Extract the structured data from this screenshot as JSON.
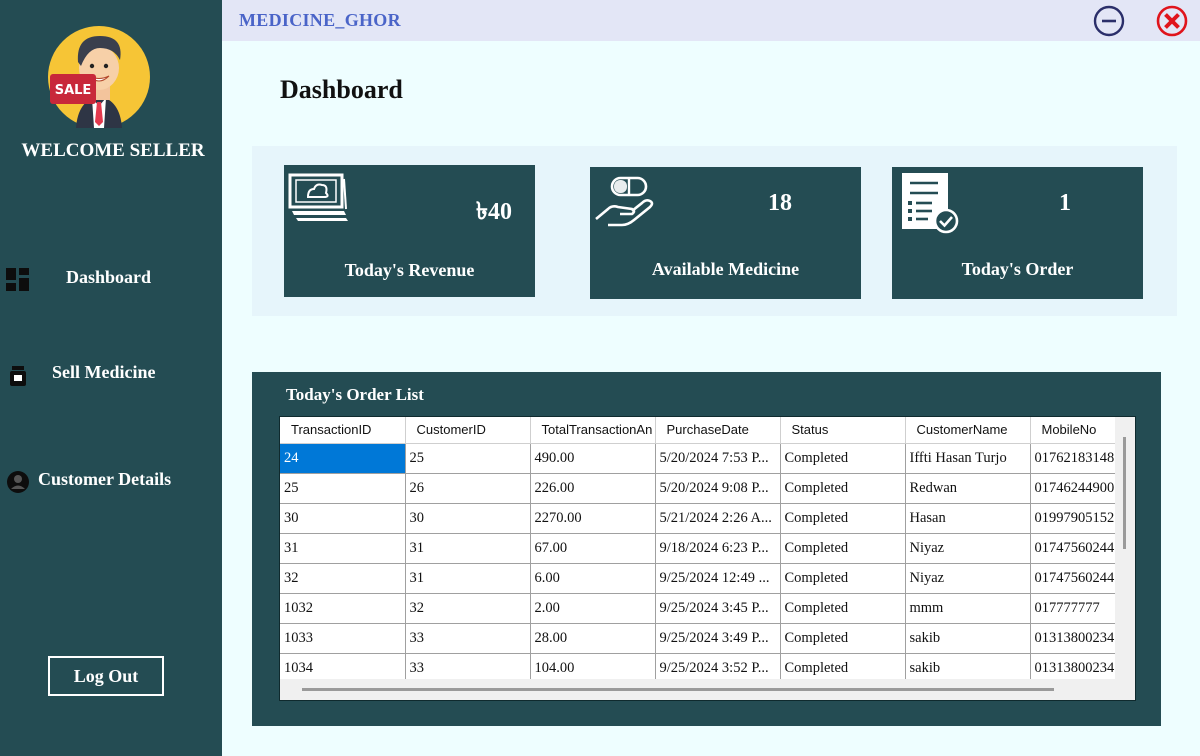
{
  "app": {
    "title": "MEDICINE_GHOR"
  },
  "sidebar": {
    "avatar_badge": "SALE",
    "welcome": "WELCOME SELLER",
    "items": [
      {
        "label": "Dashboard",
        "icon": "dashboard-icon"
      },
      {
        "label": "Sell Medicine",
        "icon": "medicine-bottle-icon"
      },
      {
        "label": "Customer Details",
        "icon": "user-icon"
      }
    ],
    "logout": "Log Out"
  },
  "main": {
    "title": "Dashboard",
    "stats": [
      {
        "value": "৳40",
        "label": "Today's Revenue",
        "icon": "money-stack-icon"
      },
      {
        "value": "18",
        "label": "Available Medicine",
        "icon": "pill-in-hand-icon"
      },
      {
        "value": "1",
        "label": "Today's Order",
        "icon": "order-checklist-icon"
      }
    ],
    "order_list": {
      "title": "Today's Order List",
      "columns": [
        "TransactionID",
        "CustomerID",
        "TotalTransactionAn",
        "PurchaseDate",
        "Status",
        "CustomerName",
        "MobileNo"
      ],
      "rows": [
        [
          "24",
          "25",
          "490.00",
          "5/20/2024 7:53 P...",
          "Completed",
          "Iffti Hasan Turjo",
          "01762183148"
        ],
        [
          "25",
          "26",
          "226.00",
          "5/20/2024 9:08 P...",
          "Completed",
          "Redwan",
          "01746244900"
        ],
        [
          "30",
          "30",
          "2270.00",
          "5/21/2024 2:26 A...",
          "Completed",
          "Hasan",
          "01997905152"
        ],
        [
          "31",
          "31",
          "67.00",
          "9/18/2024 6:23 P...",
          "Completed",
          "Niyaz",
          "01747560244"
        ],
        [
          "32",
          "31",
          "6.00",
          "9/25/2024 12:49 ...",
          "Completed",
          "Niyaz",
          "01747560244"
        ],
        [
          "1032",
          "32",
          "2.00",
          "9/25/2024 3:45 P...",
          "Completed",
          "mmm",
          "017777777"
        ],
        [
          "1033",
          "33",
          "28.00",
          "9/25/2024 3:49 P...",
          "Completed",
          "sakib",
          "01313800234"
        ],
        [
          "1034",
          "33",
          "104.00",
          "9/25/2024 3:52 P...",
          "Completed",
          "sakib",
          "01313800234"
        ]
      ]
    }
  },
  "colors": {
    "sidebar": "#244c53",
    "card": "#244c53",
    "title_accent": "#4a64c8",
    "selection": "#0078d7",
    "close": "#e0141c"
  }
}
